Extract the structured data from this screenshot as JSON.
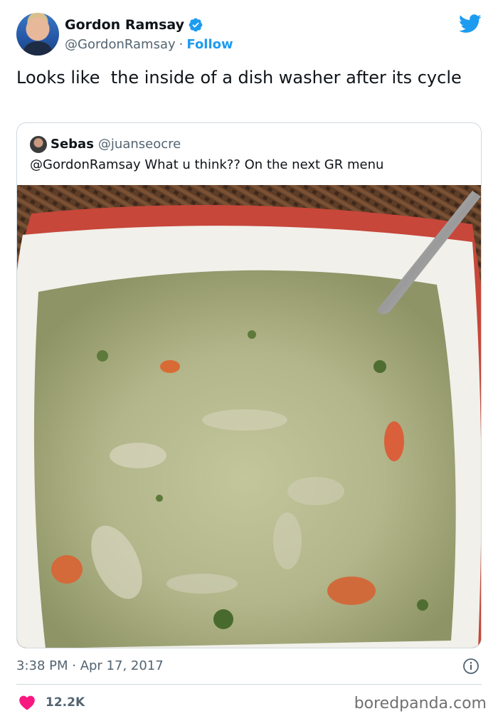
{
  "author": {
    "display_name": "Gordon Ramsay",
    "handle": "@GordonRamsay",
    "separator": "·",
    "follow_label": "Follow"
  },
  "tweet": {
    "text": "Looks like  the inside of a dish washer after its cycle"
  },
  "quoted": {
    "display_name": "Sebas",
    "handle": "@juanseocre",
    "text": "@GordonRamsay What u think?? On the next GR menu",
    "image_icon": "soup-bowl-photo"
  },
  "meta": {
    "timestamp": "3:38 PM · Apr 17, 2017",
    "like_count": "12.2K"
  },
  "watermark": "boredpanda.com",
  "icons": {
    "verified": "verified-badge-icon",
    "brand": "twitter-bird-icon",
    "info": "info-icon",
    "like": "heart-icon"
  },
  "colors": {
    "accent": "#1d9bf0",
    "heart": "#f91880",
    "muted": "#536471",
    "border": "#cfd9de"
  }
}
